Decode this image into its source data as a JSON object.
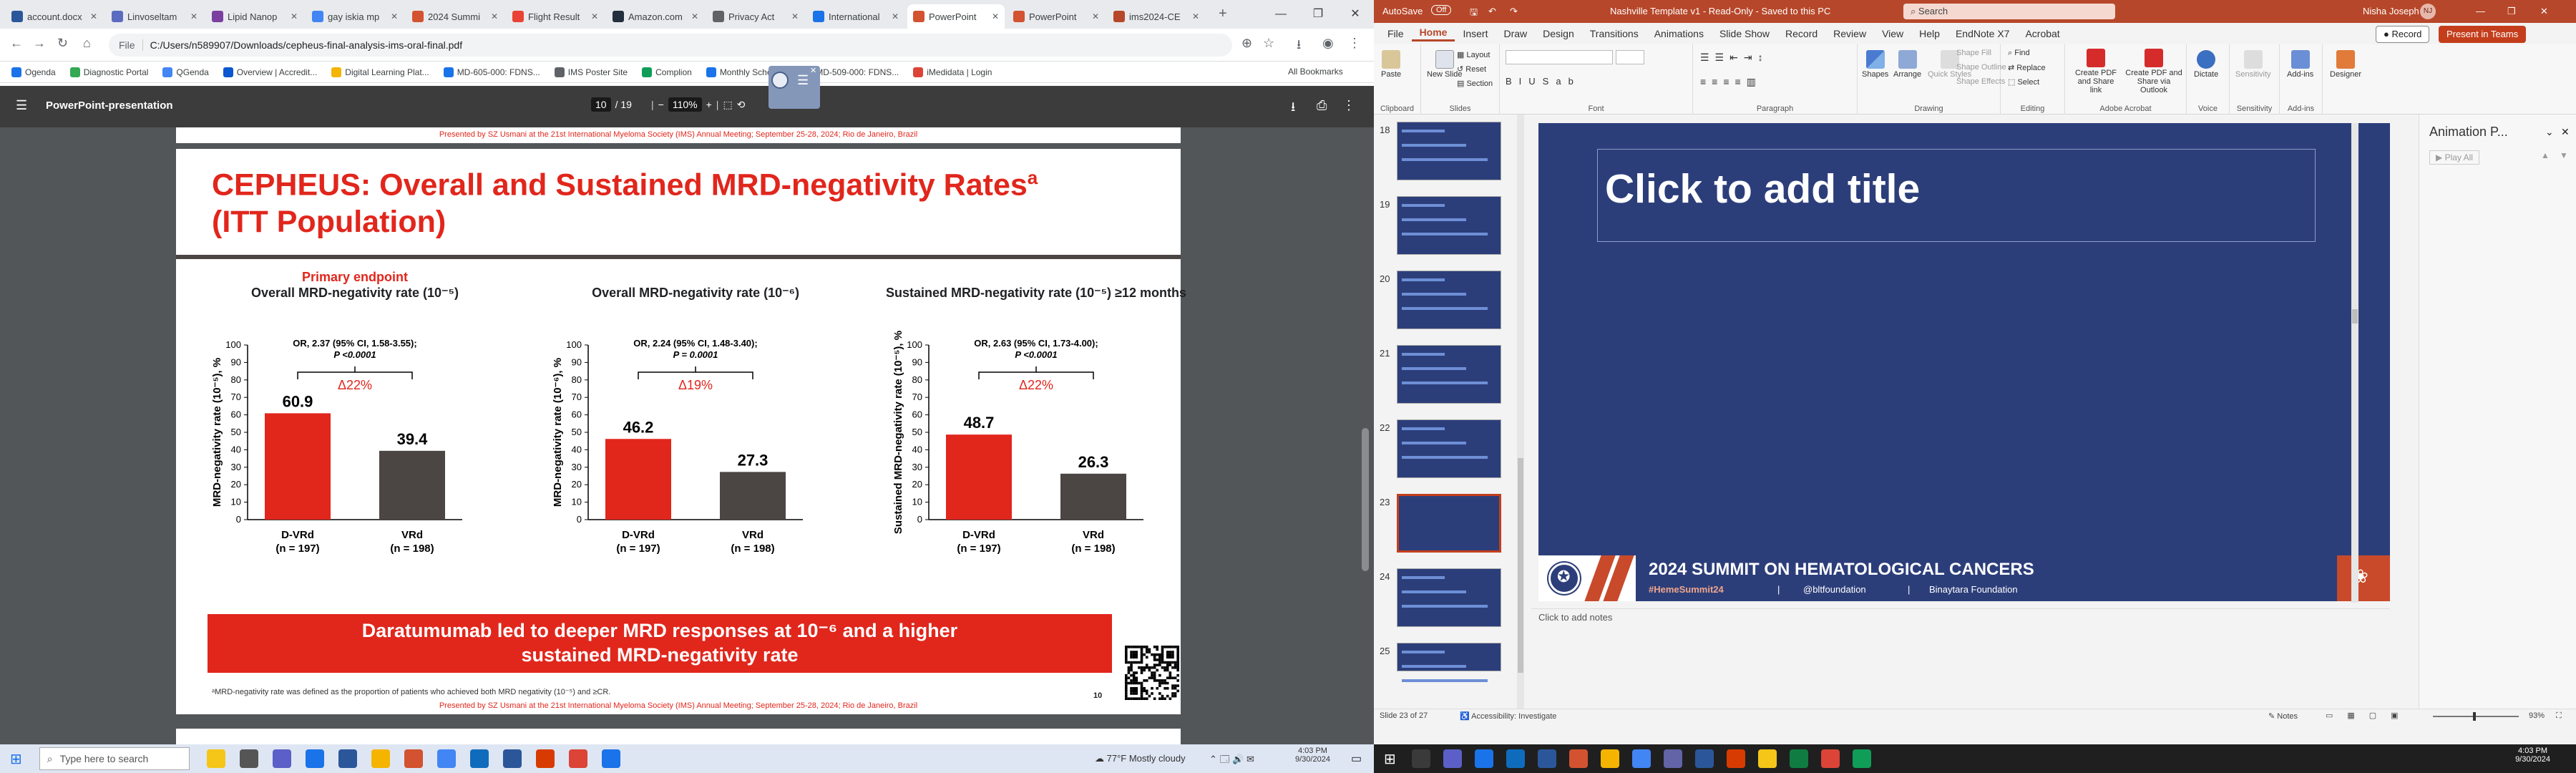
{
  "browser": {
    "tabs": [
      {
        "label": "account.docx",
        "color": "#2b579a"
      },
      {
        "label": "Linvoseltam",
        "color": "#5b6bbf"
      },
      {
        "label": "Lipid Nanop",
        "color": "#7b3fa0"
      },
      {
        "label": "gay iskia mp",
        "color": "#4285f4"
      },
      {
        "label": "2024 Summi",
        "color": "#d35230"
      },
      {
        "label": "Flight Result",
        "color": "#ea4335"
      },
      {
        "label": "Amazon.com",
        "color": "#232f3e"
      },
      {
        "label": "Privacy Act",
        "color": "#5f6368"
      },
      {
        "label": "International",
        "color": "#1a73e8"
      },
      {
        "label": "PowerPoint",
        "color": "#d35230"
      },
      {
        "label": "PowerPoint",
        "color": "#d35230"
      },
      {
        "label": "ims2024-CE",
        "color": "#b7472a"
      }
    ],
    "active_tab_index": 9,
    "window_controls": [
      "—",
      "❐",
      "✕"
    ],
    "address_label": "File",
    "address": "C:/Users/n589907/Downloads/cepheus-final-analysis-ims-oral-final.pdf",
    "bookmarks": [
      {
        "label": "Ogenda",
        "color": "#1a73e8"
      },
      {
        "label": "Diagnostic Portal",
        "color": "#34a853"
      },
      {
        "label": "QGenda",
        "color": "#4285f4"
      },
      {
        "label": "Overview | Accredit...",
        "color": "#0b57d0"
      },
      {
        "label": "Digital Learning Plat...",
        "color": "#f4b400"
      },
      {
        "label": "MD-605-000: FDNS...",
        "color": "#1a73e8"
      },
      {
        "label": "IMS Poster Site",
        "color": "#5f6368"
      },
      {
        "label": "Complion",
        "color": "#0f9d58"
      },
      {
        "label": "Monthly Schedule",
        "color": "#1a73e8"
      },
      {
        "label": "MD-509-000: FDNS...",
        "color": "#1a73e8"
      },
      {
        "label": "iMedidata | Login",
        "color": "#db4437"
      }
    ],
    "all_bookmarks": "All Bookmarks"
  },
  "pdf": {
    "title": "PowerPoint-presentation",
    "page_current": "10",
    "page_total": "/ 19",
    "zoom": "110%",
    "presented_by": "Presented by SZ Usmani at the 21st International Myeloma Society (IMS) Annual Meeting; September 25-28, 2024; Rio de Janeiro, Brazil",
    "slide_title_line1": "CEPHEUS: Overall and Sustained MRD-negativity Rates",
    "slide_title_sup": "a",
    "slide_title_line2": "(ITT Population)",
    "banner_line1": "Daratumumab led to deeper MRD responses at 10⁻⁶ and a higher",
    "banner_line2": "sustained MRD-negativity rate",
    "footnote": "ᵃMRD-negativity rate was defined as the proportion of patients who achieved both MRD negativity (10⁻⁵) and ≥CR.",
    "page_number": "10"
  },
  "chart_data": [
    {
      "type": "bar",
      "header_red": "Primary endpoint",
      "title": "Overall MRD-negativity rate (10⁻⁵)",
      "ylabel": "MRD-negativity rate (10⁻⁵), %",
      "categories": [
        "D-VRd",
        "VRd"
      ],
      "n_labels": [
        "(n = 197)",
        "(n = 198)"
      ],
      "values": [
        60.9,
        39.4
      ],
      "colors": [
        "#e1261c",
        "#4b4543"
      ],
      "ylim": [
        0,
        100
      ],
      "yticks": [
        0,
        10,
        20,
        30,
        40,
        50,
        60,
        70,
        80,
        90,
        100
      ],
      "or_text": "OR, 2.37 (95% CI, 1.58-3.55);",
      "p_text": "P <0.0001",
      "delta": "Δ22%"
    },
    {
      "type": "bar",
      "header_red": "",
      "title": "Overall MRD-negativity rate (10⁻⁶)",
      "ylabel": "MRD-negativity rate (10⁻⁶), %",
      "categories": [
        "D-VRd",
        "VRd"
      ],
      "n_labels": [
        "(n = 197)",
        "(n = 198)"
      ],
      "values": [
        46.2,
        27.3
      ],
      "colors": [
        "#e1261c",
        "#4b4543"
      ],
      "ylim": [
        0,
        100
      ],
      "yticks": [
        0,
        10,
        20,
        30,
        40,
        50,
        60,
        70,
        80,
        90,
        100
      ],
      "or_text": "OR, 2.24 (95% CI, 1.48-3.40);",
      "p_text": "P = 0.0001",
      "delta": "Δ19%"
    },
    {
      "type": "bar",
      "header_red": "",
      "title": "Sustained MRD-negativity rate (10⁻⁵) ≥12 months",
      "ylabel": "Sustained MRD-negativity rate (10⁻⁵), %",
      "categories": [
        "D-VRd",
        "VRd"
      ],
      "n_labels": [
        "(n = 197)",
        "(n = 198)"
      ],
      "values": [
        48.7,
        26.3
      ],
      "colors": [
        "#e1261c",
        "#4b4543"
      ],
      "ylim": [
        0,
        100
      ],
      "yticks": [
        0,
        10,
        20,
        30,
        40,
        50,
        60,
        70,
        80,
        90,
        100
      ],
      "or_text": "OR, 2.63 (95% CI, 1.73-4.00);",
      "p_text": "P <0.0001",
      "delta": "Δ22%"
    }
  ],
  "ppt": {
    "autosave": "AutoSave",
    "autosave_state": "Off",
    "doc_title": "Nashville Template v1 - Read-Only - Saved to this PC",
    "search_placeholder": "Search",
    "user": "Nisha Joseph",
    "user_initials": "NJ",
    "menu": [
      "File",
      "Home",
      "Insert",
      "Draw",
      "Design",
      "Transitions",
      "Animations",
      "Slide Show",
      "Record",
      "Review",
      "View",
      "Help",
      "EndNote X7",
      "Acrobat"
    ],
    "menu_selected": "Home",
    "record_btn": "Record",
    "present_btn": "Present in Teams",
    "ribbon": {
      "paste": "Paste",
      "new_slide": "New Slide",
      "layout": "Layout",
      "reset": "Reset",
      "section": "Section",
      "shapes": "Shapes",
      "arrange": "Arrange",
      "quick_styles": "Quick Styles",
      "shape_fill": "Shape Fill",
      "shape_outline": "Shape Outline",
      "shape_effects": "Shape Effects",
      "find": "Find",
      "replace": "Replace",
      "select": "Select",
      "create_pdf_share": "Create PDF and Share link",
      "create_pdf_outlook": "Create PDF and Share via Outlook",
      "dictate": "Dictate",
      "sensitivity": "Sensitivity",
      "addins": "Add-ins",
      "designer": "Designer",
      "groups": [
        "Clipboard",
        "Slides",
        "Font",
        "Paragraph",
        "Drawing",
        "Editing",
        "Adobe Acrobat",
        "Voice",
        "Sensitivity",
        "Add-ins"
      ]
    },
    "thumb_numbers": [
      "18",
      "19",
      "20",
      "21",
      "22",
      "23",
      "24",
      "25"
    ],
    "selected_thumb": "23",
    "slide_title_placeholder": "Click to add title",
    "summit_text": "2024 SUMMIT ON HEMATOLOGICAL CANCERS",
    "summit_hashtag": "#HemeSummit24",
    "summit_handle": "@bltfoundation",
    "summit_foundation": "Binaytara Foundation",
    "notes_placeholder": "Click to add notes",
    "animation_pane_title": "Animation P...",
    "play_all": "Play All",
    "status_slide": "Slide 23 of 27",
    "status_access": "Accessibility: Investigate",
    "status_notes": "Notes",
    "zoom_pct": "93%"
  },
  "taskbar_left": {
    "search_placeholder": "Type here to search",
    "weather": "77°F  Mostly cloudy",
    "time": "4:03 PM",
    "date": "9/30/2024"
  },
  "taskbar_right": {
    "time": "4:03 PM",
    "date": "9/30/2024"
  }
}
